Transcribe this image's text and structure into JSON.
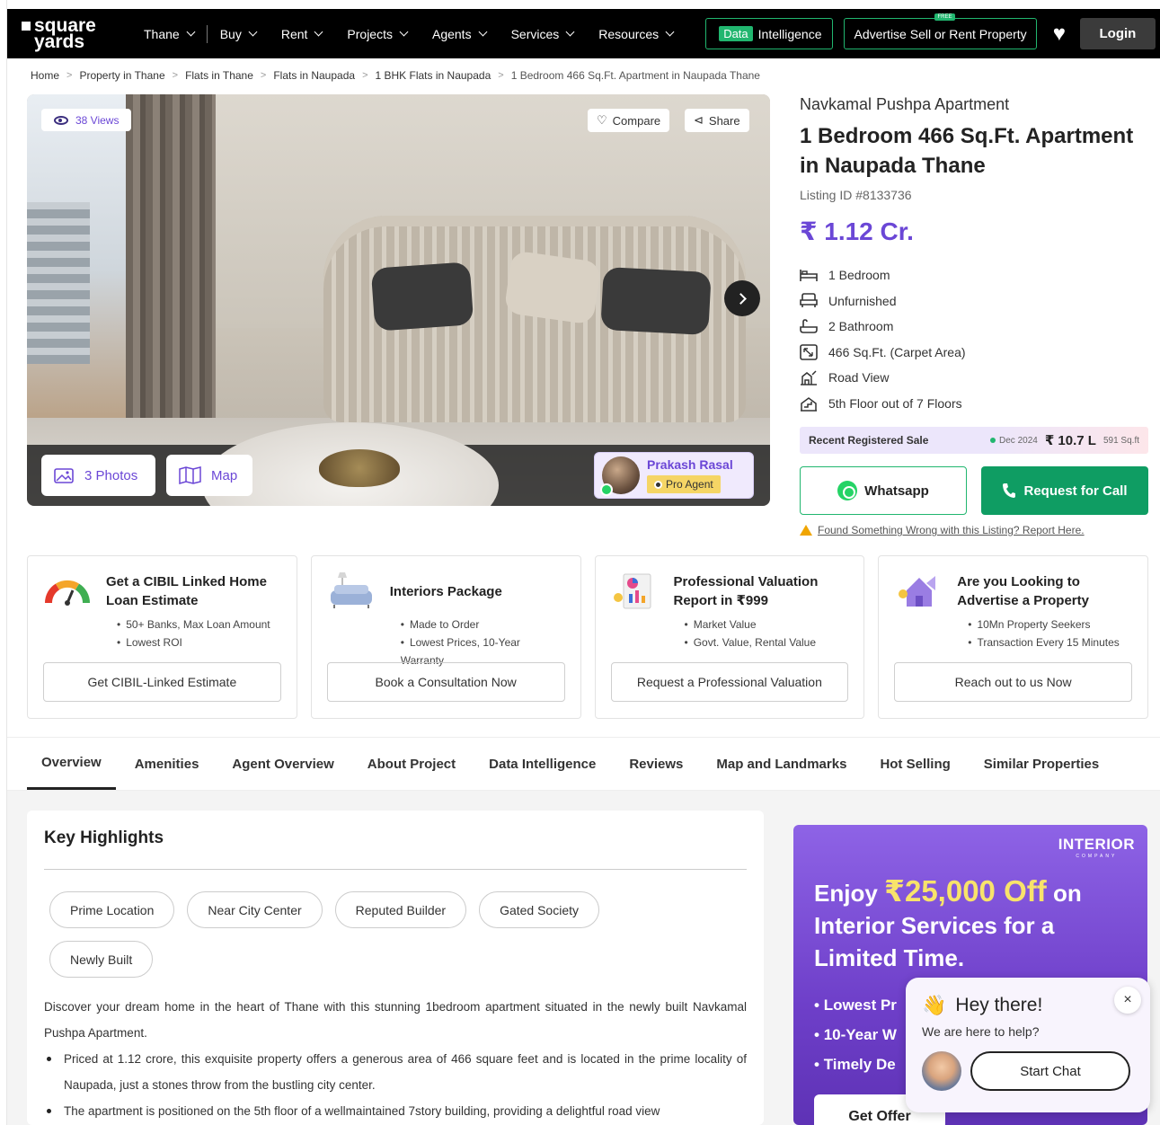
{
  "header": {
    "logo_line1": "square",
    "logo_line2": "yards",
    "nav": [
      "Thane",
      "Buy",
      "Rent",
      "Projects",
      "Agents",
      "Services",
      "Resources"
    ],
    "data_tag": "Data",
    "data_label": "Intelligence",
    "advertise_label": "Advertise Sell or Rent Property",
    "advertise_badge": "FREE",
    "login_label": "Login"
  },
  "breadcrumb": [
    "Home",
    "Property in Thane",
    "Flats in Thane",
    "Flats in Naupada",
    "1 BHK Flats in Naupada",
    "1 Bedroom 466 Sq.Ft. Apartment in Naupada Thane"
  ],
  "gallery": {
    "views": "38 Views",
    "compare_label": "Compare",
    "share_label": "Share",
    "photos_label": "3 Photos",
    "map_label": "Map",
    "agent_name": "Prakash Rasal",
    "agent_badge": "Pro Agent"
  },
  "property": {
    "project_name": "Navkamal Pushpa Apartment",
    "title": "1 Bedroom 466 Sq.Ft. Apartment in Naupada Thane",
    "listing_id": "Listing ID #8133736",
    "price": "₹ 1.12 Cr.",
    "features": [
      {
        "icon": "bed-icon",
        "label": "1 Bedroom"
      },
      {
        "icon": "sofa-icon",
        "label": "Unfurnished"
      },
      {
        "icon": "bathtub-icon",
        "label": "2 Bathroom"
      },
      {
        "icon": "area-icon",
        "label": "466 Sq.Ft. (Carpet Area)"
      },
      {
        "icon": "view-icon",
        "label": "Road View"
      },
      {
        "icon": "floor-icon",
        "label": "5th Floor out of 7 Floors"
      }
    ],
    "recent_sale_label": "Recent Registered Sale",
    "recent_sale_date": "Dec 2024",
    "recent_sale_amount": "₹ 10.7 L",
    "recent_sale_area": "591 Sq.ft",
    "whatsapp_label": "Whatsapp",
    "call_label": "Request for Call",
    "report_label": "Found Something Wrong with this Listing? Report Here."
  },
  "cards": [
    {
      "icon": "gauge-icon",
      "title": "Get a CIBIL Linked Home Loan Estimate",
      "bullets": [
        "50+ Banks, Max Loan Amount",
        "Lowest ROI"
      ],
      "button": "Get CIBIL-Linked Estimate"
    },
    {
      "icon": "sofa-lamp-icon",
      "title": "Interiors Package",
      "bullets": [
        "Made to Order",
        "Lowest Prices, 10-Year Warranty"
      ],
      "button": "Book a Consultation Now"
    },
    {
      "icon": "report-chart-icon",
      "title": "Professional Valuation Report in ₹999",
      "bullets": [
        "Market Value",
        "Govt. Value, Rental Value"
      ],
      "button": "Request a Professional Valuation"
    },
    {
      "icon": "house-megaphone-icon",
      "title": "Are you Looking to Advertise a Property",
      "bullets": [
        "10Mn Property Seekers",
        "Transaction Every 15 Minutes"
      ],
      "button": "Reach out to us Now"
    }
  ],
  "tabs": [
    "Overview",
    "Amenities",
    "Agent Overview",
    "About Project",
    "Data Intelligence",
    "Reviews",
    "Map and Landmarks",
    "Hot Selling",
    "Similar Properties"
  ],
  "highlights": {
    "title": "Key Highlights",
    "pills": [
      "Prime Location",
      "Near City Center",
      "Reputed Builder",
      "Gated Society",
      "Newly Built"
    ],
    "intro": "Discover your dream home in the heart of Thane with this stunning 1bedroom apartment situated in the newly built Navkamal Pushpa Apartment.",
    "points": [
      "Priced at 1.12 crore, this exquisite property offers a generous area of 466 square feet and is located in the prime locality of Naupada, just a stones throw from the bustling city center.",
      "The apartment is positioned on the 5th floor of a wellmaintained 7story building, providing a delightful road view"
    ]
  },
  "promo": {
    "logo": "INTERIOR",
    "logo_sub": "COMPANY",
    "head_pre": "Enjoy ",
    "head_big": "₹25,000 Off",
    "head_post": " on Interior Services for a Limited Time.",
    "list": [
      "Lowest Pr",
      "10-Year W",
      "Timely De"
    ],
    "button": "Get Offer"
  },
  "chat": {
    "title": "Hey there!",
    "subtitle": "We are here to help?",
    "button": "Start Chat",
    "close": "×"
  },
  "colors": {
    "brand_purple": "#6b47d6",
    "brand_green": "#0f9d63",
    "header_bg": "#000000"
  }
}
